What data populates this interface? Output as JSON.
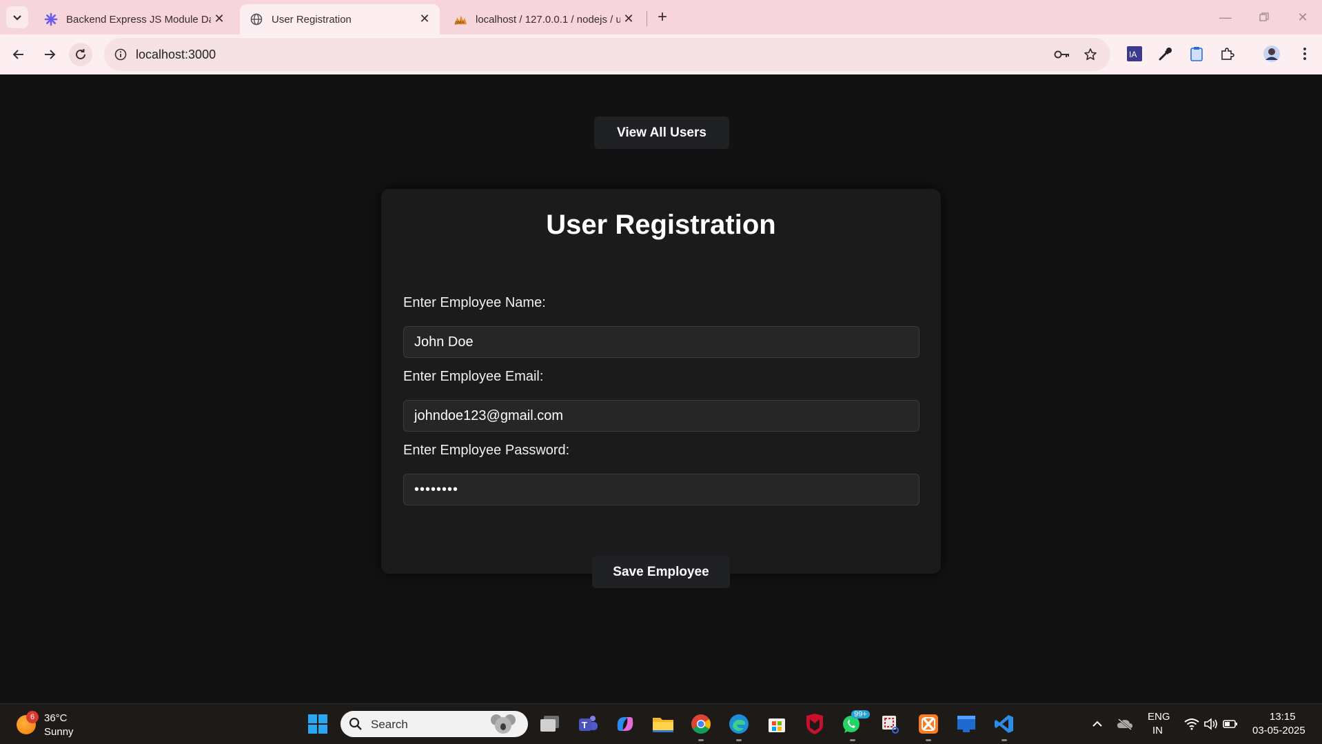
{
  "browser": {
    "tabs": [
      {
        "title": "Backend Express JS Module Day",
        "icon": "spark-icon",
        "active": false
      },
      {
        "title": "User Registration",
        "icon": "globe-icon",
        "active": true
      },
      {
        "title": "localhost / 127.0.0.1 / nodejs / u",
        "icon": "phpmyadmin-icon",
        "active": false
      }
    ],
    "url": "localhost:3000"
  },
  "page": {
    "view_users_label": "View All Users",
    "form": {
      "title": "User Registration",
      "fields": [
        {
          "label": "Enter Employee Name:",
          "value": "John Doe",
          "type": "text"
        },
        {
          "label": "Enter Employee Email:",
          "value": "johndoe123@gmail.com",
          "type": "email"
        },
        {
          "label": "Enter Employee Password:",
          "value": "••••••••",
          "type": "password"
        }
      ],
      "submit_label": "Save Employee"
    }
  },
  "taskbar": {
    "weather": {
      "temp": "36°C",
      "condition": "Sunny",
      "badge": "6"
    },
    "search_placeholder": "Search",
    "whatsapp_badge": "99+",
    "tray": {
      "lang_top": "ENG",
      "lang_bottom": "IN",
      "time": "13:15",
      "date": "03-05-2025"
    }
  },
  "colors": {
    "tabbar_bg": "#f6d6dc",
    "toolbar_bg": "#fdeef1",
    "page_bg": "#121212",
    "card_bg": "#1b1b1b",
    "button_bg": "#1f2124",
    "input_bg": "#262626"
  }
}
